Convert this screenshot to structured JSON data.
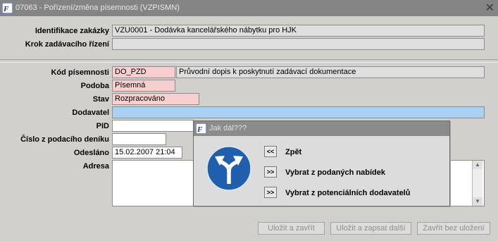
{
  "window": {
    "title": "07063 - Pořízení/změna písemnosti (VZPISMN)",
    "close": "✕"
  },
  "labels": {
    "identifikace": "Identifikace zakázky",
    "krok": "Krok zadávacího řízení",
    "kod": "Kód písemnosti",
    "podoba": "Podoba",
    "stav": "Stav",
    "dodavatel": "Dodavatel",
    "pid": "PID",
    "cislo": "Číslo z podacího deníku",
    "odeslano": "Odesláno",
    "adresa": "Adresa"
  },
  "values": {
    "identifikace": "VZU0001 - Dodávka kancelářského nábytku pro HJK",
    "krok": "",
    "kod": "DO_PZD",
    "kod_desc": "Průvodní dopis k poskytnutí zadávací dokumentace",
    "podoba": "Písemná",
    "stav": "Rozpracováno",
    "dodavatel": "",
    "pid": "",
    "cislo": "",
    "odeslano": "15.02.2007 21:04",
    "adresa": ""
  },
  "buttons": {
    "save_close": "Uložit a zavřít",
    "save_next": "Uložit a zapsat další",
    "close_no_save": "Zavřít bez uložení"
  },
  "dialog": {
    "title": "Jak dál???",
    "options": [
      {
        "btn": "<<",
        "label": "Zpět"
      },
      {
        "btn": ">>",
        "label": "Vybrat z podaných nabídek"
      },
      {
        "btn": ">>",
        "label": "Vybrat z potenciálních dodavatelů"
      }
    ]
  },
  "colors": {
    "required": "#f8cfcf",
    "focus": "#a9d1f6",
    "sign_blue": "#1f5fae"
  }
}
